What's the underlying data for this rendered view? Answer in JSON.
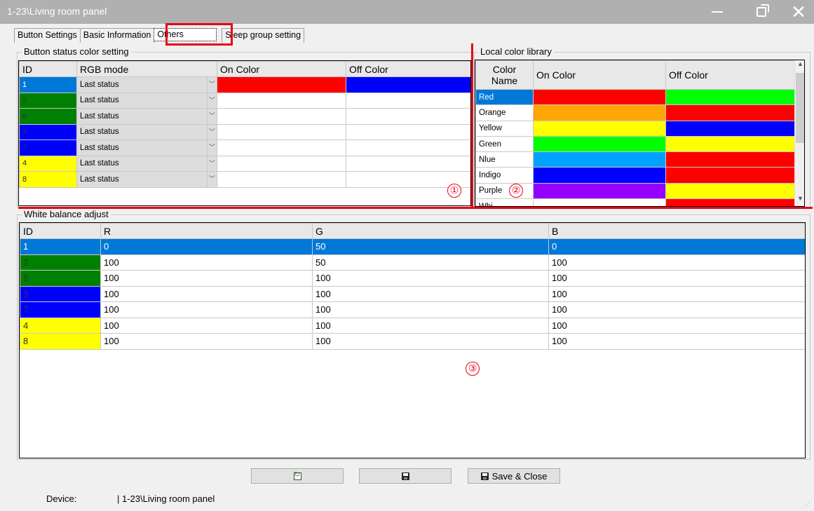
{
  "window": {
    "title": "1-23\\Living room panel",
    "min_icon": "minimize-icon",
    "max_icon": "restore-icon",
    "close_icon": "close-icon",
    "close_glyph": "✕"
  },
  "tabs": [
    "Button Settings",
    "Basic Information",
    "Others",
    "Sleep group setting"
  ],
  "button_status": {
    "title": "Button status color setting",
    "headers": [
      "ID",
      "RGB mode",
      "On Color",
      "Off Color"
    ],
    "rows": [
      {
        "id": "1",
        "id_color": "#0078d7",
        "mode": "Last status",
        "on": "#ff0000",
        "off": "#0000ff"
      },
      {
        "id": "2",
        "id_color": "#008000",
        "mode": "Last status",
        "on": "",
        "off": ""
      },
      {
        "id": "6",
        "id_color": "#008000",
        "mode": "Last status",
        "on": "",
        "off": ""
      },
      {
        "id": "3",
        "id_color": "#0000ff",
        "mode": "Last status",
        "on": "",
        "off": ""
      },
      {
        "id": "7",
        "id_color": "#0000ff",
        "mode": "Last status",
        "on": "",
        "off": ""
      },
      {
        "id": "4",
        "id_color": "#ffff00",
        "mode": "Last status",
        "on": "",
        "off": ""
      },
      {
        "id": "8",
        "id_color": "#ffff00",
        "mode": "Last status",
        "on": "",
        "off": ""
      }
    ]
  },
  "color_library": {
    "title": "Local color library",
    "headers": [
      "Color\nName",
      "On Color",
      "Off Color"
    ],
    "rows": [
      {
        "name": "Red",
        "on": "#ff0000",
        "off": "#00ff00"
      },
      {
        "name": "Orange",
        "on": "#ffa500",
        "off": "#ff0000"
      },
      {
        "name": "Yellow",
        "on": "#ffff00",
        "off": "#0000ff"
      },
      {
        "name": "Green",
        "on": "#00ff00",
        "off": "#ffff00"
      },
      {
        "name": "Nlue",
        "on": "#00a2ff",
        "off": "#ff0000"
      },
      {
        "name": "Indigo",
        "on": "#0000ff",
        "off": "#ff0000"
      },
      {
        "name": "Purple",
        "on": "#9400ff",
        "off": "#ffff00"
      },
      {
        "name": "Whi",
        "on": "",
        "off": "#ff0000"
      }
    ]
  },
  "white_balance": {
    "title": "White balance adjust",
    "headers": [
      "ID",
      "R",
      "G",
      "B"
    ],
    "rows": [
      {
        "id": "1",
        "id_color": "#0078d7",
        "r": "0",
        "g": "50",
        "b": "0"
      },
      {
        "id": "2",
        "id_color": "#008000",
        "r": "100",
        "g": "50",
        "b": "100"
      },
      {
        "id": "6",
        "id_color": "#008000",
        "r": "100",
        "g": "100",
        "b": "100"
      },
      {
        "id": "3",
        "id_color": "#0000ff",
        "r": "100",
        "g": "100",
        "b": "100"
      },
      {
        "id": "7",
        "id_color": "#0000ff",
        "r": "100",
        "g": "100",
        "b": "100"
      },
      {
        "id": "4",
        "id_color": "#ffff00",
        "r": "100",
        "g": "100",
        "b": "100"
      },
      {
        "id": "8",
        "id_color": "#ffff00",
        "r": "100",
        "g": "100",
        "b": "100"
      }
    ]
  },
  "annotations": [
    "①",
    "②",
    "③"
  ],
  "buttons": {
    "refresh_icon": "refresh-icon",
    "save_icon": "save-icon",
    "save_close_label": "Save & Close"
  },
  "status": {
    "device_label": "Device:",
    "device_value": "| 1-23\\Living room panel"
  },
  "colors": {
    "highlight": "#e50012",
    "selection": "#0078d7"
  }
}
